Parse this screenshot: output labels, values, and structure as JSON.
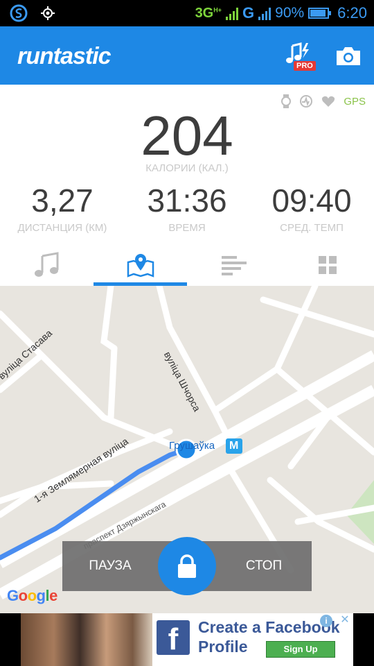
{
  "status_bar": {
    "network": "3G",
    "network_sup": "H+",
    "network2": "G",
    "battery_percent": "90%",
    "battery_level": 0.9,
    "time": "6:20",
    "icons": [
      "s-app-icon",
      "gps-target-icon"
    ]
  },
  "app_bar": {
    "logo": "runtastic",
    "pro_badge": "PRO",
    "icons": [
      "music-pro-icon",
      "camera-icon"
    ]
  },
  "indicators": {
    "gps_label": "GPS",
    "icons": [
      "watch-icon",
      "heart-rate-monitor-icon",
      "heart-icon"
    ]
  },
  "stats": {
    "calories": {
      "value": "204",
      "label": "КАЛОРИИ (КАЛ.)"
    },
    "distance": {
      "value": "3,27",
      "label": "ДИСТАНЦИЯ (КМ)"
    },
    "time": {
      "value": "31:36",
      "label": "ВРЕМЯ"
    },
    "pace": {
      "value": "09:40",
      "label": "СРЕД. ТЕМП"
    }
  },
  "tabs": [
    {
      "name": "music",
      "icon": "music-note-icon",
      "active": false
    },
    {
      "name": "map",
      "icon": "map-pin-icon",
      "active": true
    },
    {
      "name": "splits",
      "icon": "bars-icon",
      "active": false
    },
    {
      "name": "dashboard",
      "icon": "grid-icon",
      "active": false
    }
  ],
  "map": {
    "streets": [
      "вуліца Стасава",
      "вуліца Шчорса",
      "1-я Землямерная вуліца",
      "праспект Дзяржынскага"
    ],
    "metro_station": "Грушаўка",
    "metro_badge": "M",
    "attribution": "Google",
    "route_color": "#4a8df0"
  },
  "controls": {
    "pause_label": "ПАУЗА",
    "stop_label": "СТОП",
    "lock_icon": "lock-icon"
  },
  "ad": {
    "line1": "Create a Facebook",
    "line2": "Profile",
    "button_label": "Sign Up",
    "fb_letter": "f",
    "info_label": "i",
    "close_label": "✕"
  },
  "colors": {
    "accent": "#1e88e5",
    "gps": "#8bc34a",
    "stat_value": "#3d3d3d",
    "stat_label": "#c9c9c9"
  }
}
